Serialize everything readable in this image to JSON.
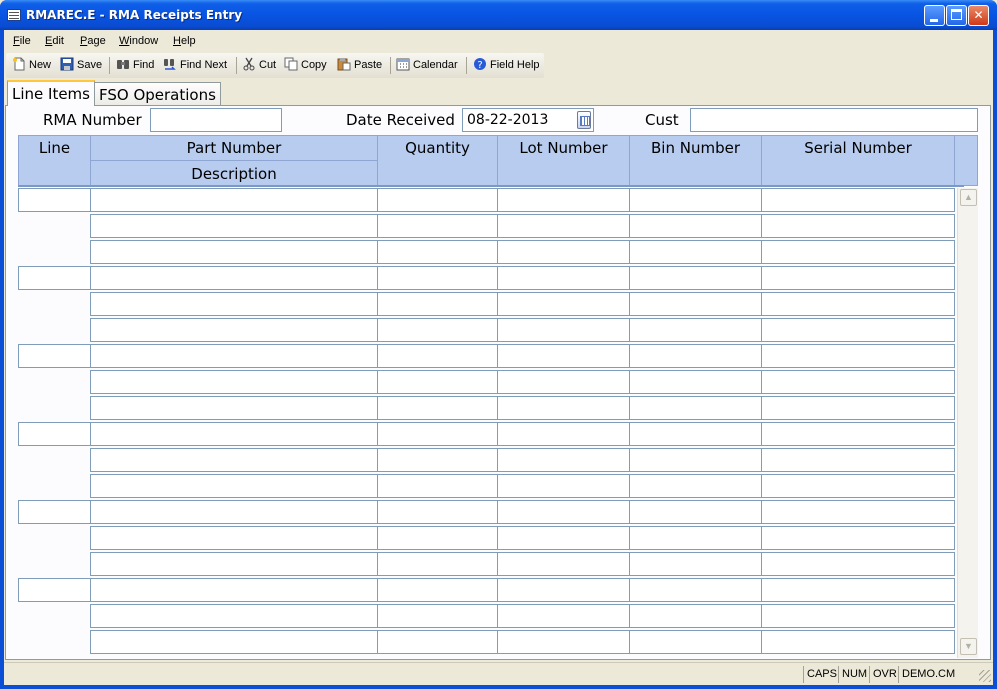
{
  "window": {
    "title": "RMAREC.E - RMA Receipts Entry"
  },
  "menu": [
    {
      "hot": "F",
      "rest": "ile"
    },
    {
      "hot": "E",
      "rest": "dit"
    },
    {
      "hot": "P",
      "rest": "age"
    },
    {
      "hot": "W",
      "rest": "indow"
    },
    {
      "hot": "H",
      "rest": "elp"
    }
  ],
  "toolbar": {
    "new": "New",
    "save": "Save",
    "find": "Find",
    "find_next": "Find Next",
    "cut": "Cut",
    "copy": "Copy",
    "paste": "Paste",
    "calendar": "Calendar",
    "field_help": "Field Help"
  },
  "tabs": {
    "line_items": "Line Items",
    "fso_operations": "FSO Operations"
  },
  "form": {
    "rma_number_label": "RMA Number",
    "rma_number_value": "",
    "date_received_label": "Date Received",
    "date_received_value": "08-22-2013",
    "cust_label": "Cust",
    "cust_value": ""
  },
  "grid": {
    "headers": {
      "line": "Line",
      "part_number": "Part Number",
      "description": "Description",
      "quantity": "Quantity",
      "lot_number": "Lot Number",
      "bin_number": "Bin Number",
      "serial_number": "Serial Number"
    }
  },
  "status": {
    "caps": "CAPS",
    "num": "NUM",
    "ovr": "OVR",
    "account": "DEMO.CM"
  }
}
